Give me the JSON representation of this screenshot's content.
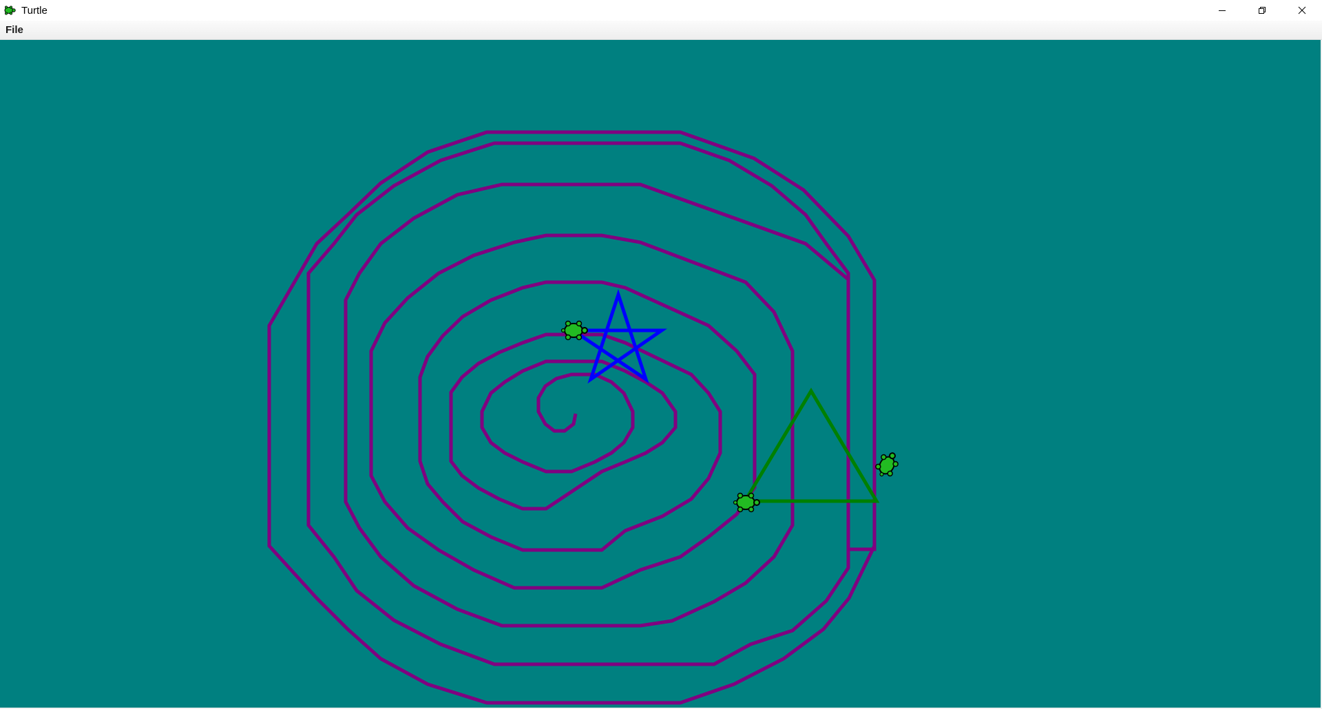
{
  "window": {
    "title": "Turtle",
    "app_icon": "turtle-icon",
    "controls": {
      "minimize_icon": "minimize-icon",
      "maximize_icon": "restore-icon",
      "close_icon": "close-icon"
    }
  },
  "menubar": {
    "items": [
      {
        "label": "File"
      }
    ]
  },
  "canvas": {
    "background_color": "#008080",
    "drawings": [
      {
        "name": "spiral",
        "shape": "decagon spiral",
        "color": "#800080"
      },
      {
        "name": "star",
        "shape": "five-pointed star",
        "color": "#0000ff"
      },
      {
        "name": "triangle",
        "shape": "triangle",
        "color": "#008000"
      }
    ],
    "turtles": [
      {
        "name": "turtle-star",
        "icon": "turtle-icon",
        "fill": "#22bb22"
      },
      {
        "name": "turtle-triangle",
        "icon": "turtle-icon",
        "fill": "#22bb22"
      },
      {
        "name": "turtle-spiral",
        "icon": "turtle-icon",
        "fill": "#22bb22"
      }
    ]
  }
}
